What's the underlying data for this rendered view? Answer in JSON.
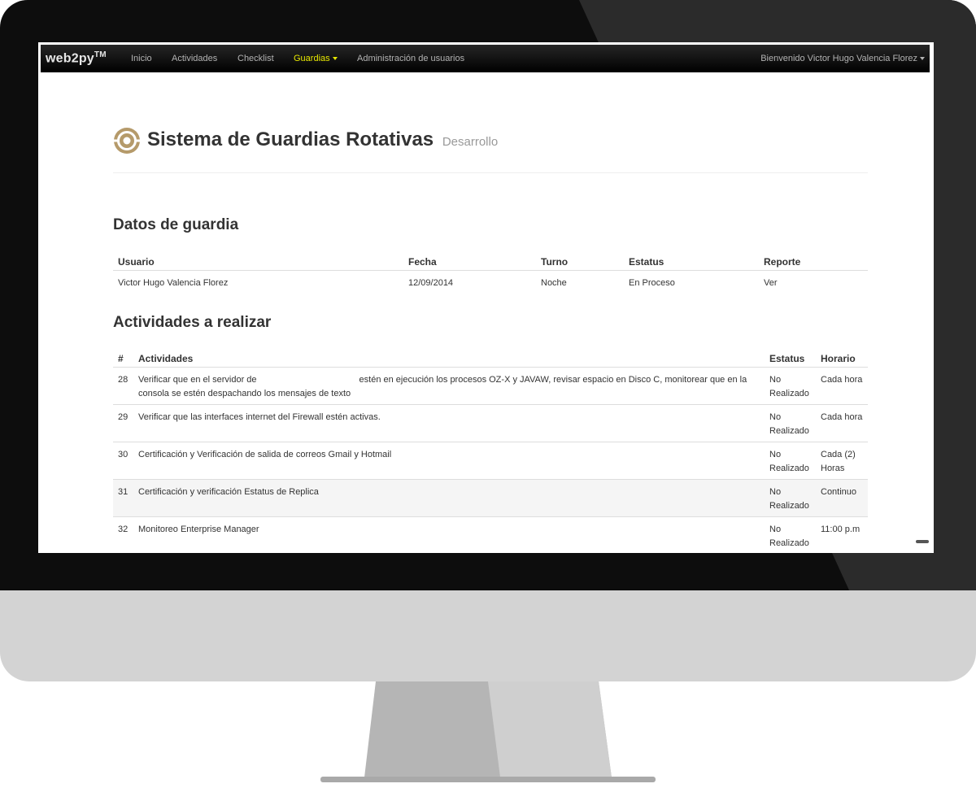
{
  "navbar": {
    "brand": "web2py",
    "brand_tm": "TM",
    "items": [
      {
        "label": "Inicio"
      },
      {
        "label": "Actividades"
      },
      {
        "label": "Checklist"
      },
      {
        "label": "Guardias",
        "active": true,
        "dropdown": true
      },
      {
        "label": "Administración de usuarios"
      }
    ],
    "welcome": "Bienvenido Victor Hugo Valencia Florez"
  },
  "header": {
    "title": "Sistema de Guardias Rotativas",
    "subtitle": "Desarrollo"
  },
  "guard": {
    "title": "Datos de guardia",
    "columns": [
      "Usuario",
      "Fecha",
      "Turno",
      "Estatus",
      "Reporte"
    ],
    "row": {
      "usuario": "Victor Hugo Valencia Florez",
      "fecha": "12/09/2014",
      "turno": "Noche",
      "estatus": "En Proceso",
      "reporte": "Ver"
    }
  },
  "activities": {
    "title": "Actividades a realizar",
    "columns": [
      "#",
      "Actividades",
      "Estatus",
      "Horario"
    ],
    "rows": [
      {
        "num": "28",
        "text_a": "Verificar que en el servidor de",
        "text_b": "estén en ejecución los procesos OZ-X y JAVAW, revisar espacio en Disco C, monitorear que en la consola se estén despachando los mensajes de texto",
        "estatus": "No Realizado",
        "horario": "Cada hora"
      },
      {
        "num": "29",
        "text": "Verificar que las interfaces internet del Firewall estén activas.",
        "estatus": "No Realizado",
        "horario": "Cada hora"
      },
      {
        "num": "30",
        "text": "Certificación y Verificación de salida de correos Gmail y Hotmail",
        "estatus": "No Realizado",
        "horario": "Cada (2) Horas"
      },
      {
        "num": "31",
        "text": "Certificación y verificación Estatus de Replica",
        "estatus": "No Realizado",
        "horario": "Continuo"
      },
      {
        "num": "32",
        "text": "Monitoreo Enterprise Manager",
        "estatus": "No Realizado",
        "horario": "11:00 p.m"
      }
    ]
  },
  "colors": {
    "link": "#0088cc",
    "success": "#0ea01a",
    "danger": "#ee1c1c",
    "nav_active": "#e8e800",
    "logo": "#b59a6a"
  },
  "icons": {
    "logo": "gear-logo-icon",
    "dropdown": "caret-down-icon"
  }
}
